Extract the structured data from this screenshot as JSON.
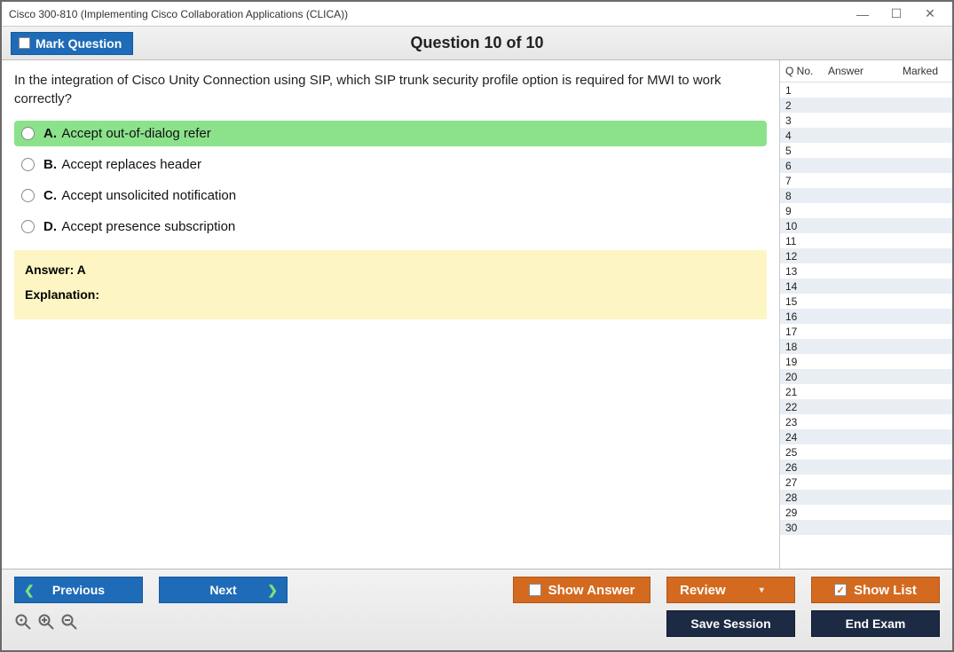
{
  "window": {
    "title": "Cisco 300-810 (Implementing Cisco Collaboration Applications (CLICA))"
  },
  "header": {
    "mark_label": "Mark Question",
    "question_title": "Question 10 of 10"
  },
  "question": {
    "text": "In the integration of Cisco Unity Connection using SIP, which SIP trunk security profile option is required for MWI to work correctly?",
    "choices": [
      {
        "letter": "A.",
        "text": "Accept out-of-dialog refer",
        "selected": true
      },
      {
        "letter": "B.",
        "text": "Accept replaces header",
        "selected": false
      },
      {
        "letter": "C.",
        "text": "Accept unsolicited notification",
        "selected": false
      },
      {
        "letter": "D.",
        "text": "Accept presence subscription",
        "selected": false
      }
    ],
    "answer_line": "Answer: A",
    "explanation_label": "Explanation:"
  },
  "sidebar": {
    "headers": {
      "qno": "Q No.",
      "answer": "Answer",
      "marked": "Marked"
    },
    "count": 30
  },
  "footer": {
    "previous": "Previous",
    "next": "Next",
    "show_answer": "Show Answer",
    "review": "Review",
    "show_list": "Show List",
    "save_session": "Save Session",
    "end_exam": "End Exam"
  }
}
